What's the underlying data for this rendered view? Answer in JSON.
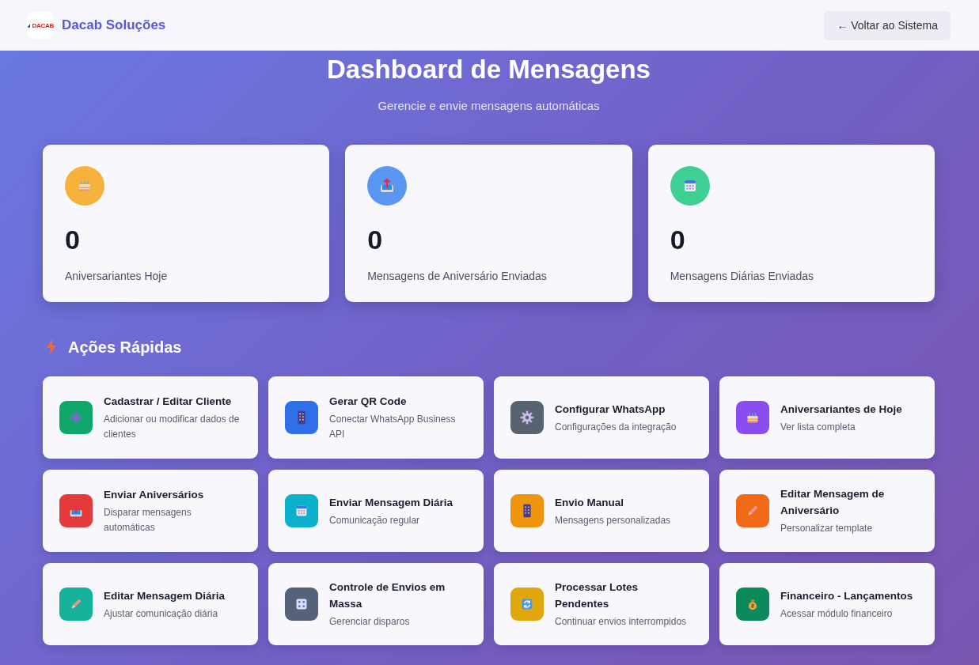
{
  "header": {
    "brand": "Dacab Soluções",
    "logo_text": "DACAB",
    "back_button": "← Voltar ao Sistema"
  },
  "page": {
    "title": "Dashboard de Mensagens",
    "subtitle": "Gerencie e envie mensagens automáticas"
  },
  "stats": [
    {
      "value": "0",
      "label": "Aniversariantes Hoje",
      "color": "#f6b23c"
    },
    {
      "value": "0",
      "label": "Mensagens de Aniversário Enviadas",
      "color": "#5a97f2"
    },
    {
      "value": "0",
      "label": "Mensagens Diárias Enviadas",
      "color": "#3fcf95"
    }
  ],
  "quick_actions": {
    "title": "Ações Rápidas",
    "items": [
      {
        "title": "Cadastrar / Editar Cliente",
        "description": "Adicionar ou modificar dados de clientes",
        "color": "#10a86a"
      },
      {
        "title": "Gerar QR Code",
        "description": "Conectar WhatsApp Business API",
        "color": "#2f6fe8"
      },
      {
        "title": "Configurar WhatsApp",
        "description": "Configurações da integração",
        "color": "#59626f"
      },
      {
        "title": "Aniversariantes de Hoje",
        "description": "Ver lista completa",
        "color": "#8b4cf0"
      },
      {
        "title": "Enviar Aniversários",
        "description": "Disparar mensagens automáticas",
        "color": "#e33a3a"
      },
      {
        "title": "Enviar Mensagem Diária",
        "description": "Comunicação regular",
        "color": "#0ab0cc"
      },
      {
        "title": "Envio Manual",
        "description": "Mensagens personalizadas",
        "color": "#ef950c"
      },
      {
        "title": "Editar Mensagem de Aniversário",
        "description": "Personalizar template",
        "color": "#f26a18"
      },
      {
        "title": "Editar Mensagem Diária",
        "description": "Ajustar comunicação diária",
        "color": "#14b39a"
      },
      {
        "title": "Controle de Envios em Massa",
        "description": "Gerenciar disparos",
        "color": "#56627a"
      },
      {
        "title": "Processar Lotes Pendentes",
        "description": "Continuar envios interrompidos",
        "color": "#e0a80c"
      },
      {
        "title": "Financeiro - Lançamentos",
        "description": "Acessar módulo financeiro",
        "color": "#0c8a5c"
      }
    ]
  }
}
